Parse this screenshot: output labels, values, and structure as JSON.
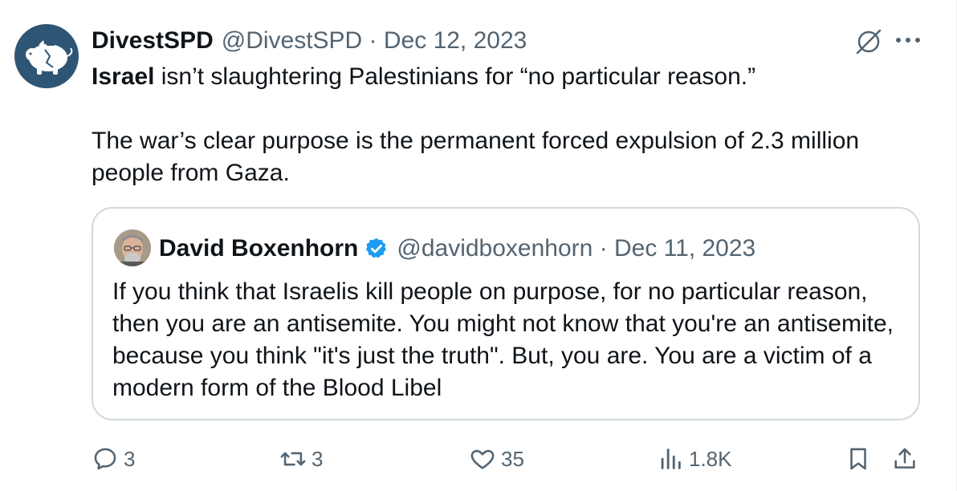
{
  "tweet": {
    "author_name": "DivestSPD",
    "meta": "@DivestSPD · Dec 12, 2023",
    "text_bold": "Israel",
    "text_line1_rest": " isn’t slaughtering Palestinians for “no particular reason.”",
    "text_para2": "The war’s clear purpose is the permanent forced expulsion of 2.3 million people from Gaza."
  },
  "quote": {
    "author_name": "David Boxenhorn",
    "meta": "@davidboxenhorn · Dec 11, 2023",
    "text": "If you think that Israelis kill people on purpose, for no particular reason, then you are an antisemite. You might not know that you're an antisemite, because you think \"it's just the truth\". But, you are. You are a victim of a modern form of the Blood Libel"
  },
  "actions": {
    "replies": "3",
    "reposts": "3",
    "likes": "35",
    "views": "1.8K"
  },
  "icons": {
    "avatar": "piggy-bank-icon",
    "grok": "grok-icon",
    "more": "more-icon",
    "verified": "verified-badge-icon",
    "reply": "reply-icon",
    "repost": "repost-icon",
    "like": "heart-icon",
    "views": "views-icon",
    "bookmark": "bookmark-icon",
    "share": "share-icon"
  },
  "colors": {
    "text": "#0f1419",
    "secondary": "#536471",
    "verified": "#1d9bf0",
    "border": "#cfd9de",
    "avatar_bg": "#2e5574"
  }
}
